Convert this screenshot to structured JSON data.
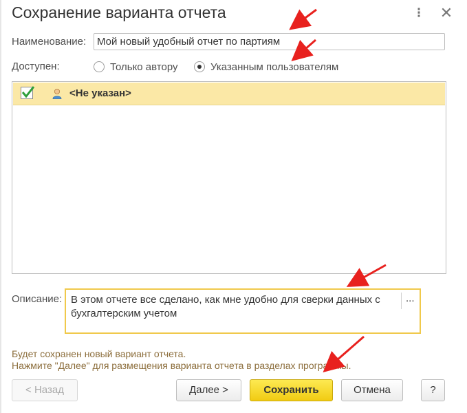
{
  "dialog": {
    "title": "Сохранение варианта отчета",
    "more_icon": "vertical-dots-icon",
    "close_icon": "close-icon"
  },
  "form": {
    "name_label": "Наименование:",
    "name_value": "Мой новый удобный отчет по партиям",
    "access_label": "Доступен:",
    "access_options": [
      {
        "label": "Только автору",
        "selected": false
      },
      {
        "label": "Указанным пользователям",
        "selected": true
      }
    ],
    "users": [
      {
        "name": "<Не указан>",
        "checked": true,
        "icon": "user-icon"
      }
    ],
    "description_label": "Описание:",
    "description_value": "В этом отчете все сделано, как мне удобно для сверки данных с бухгалтерским учетом",
    "description_button": "..."
  },
  "info": {
    "line1": "Будет сохранен новый вариант отчета.",
    "line2": "Нажмите \"Далее\" для размещения варианта отчета в разделах программы."
  },
  "buttons": {
    "back": "< Назад",
    "next": "Далее >",
    "save": "Сохранить",
    "cancel": "Отмена",
    "help": "?"
  },
  "colors": {
    "accent_yellow": "#f4d02a",
    "selected_row": "#fbe8a6",
    "annotation_arrow": "#e8211e",
    "checkmark": "#2e9e3a"
  }
}
